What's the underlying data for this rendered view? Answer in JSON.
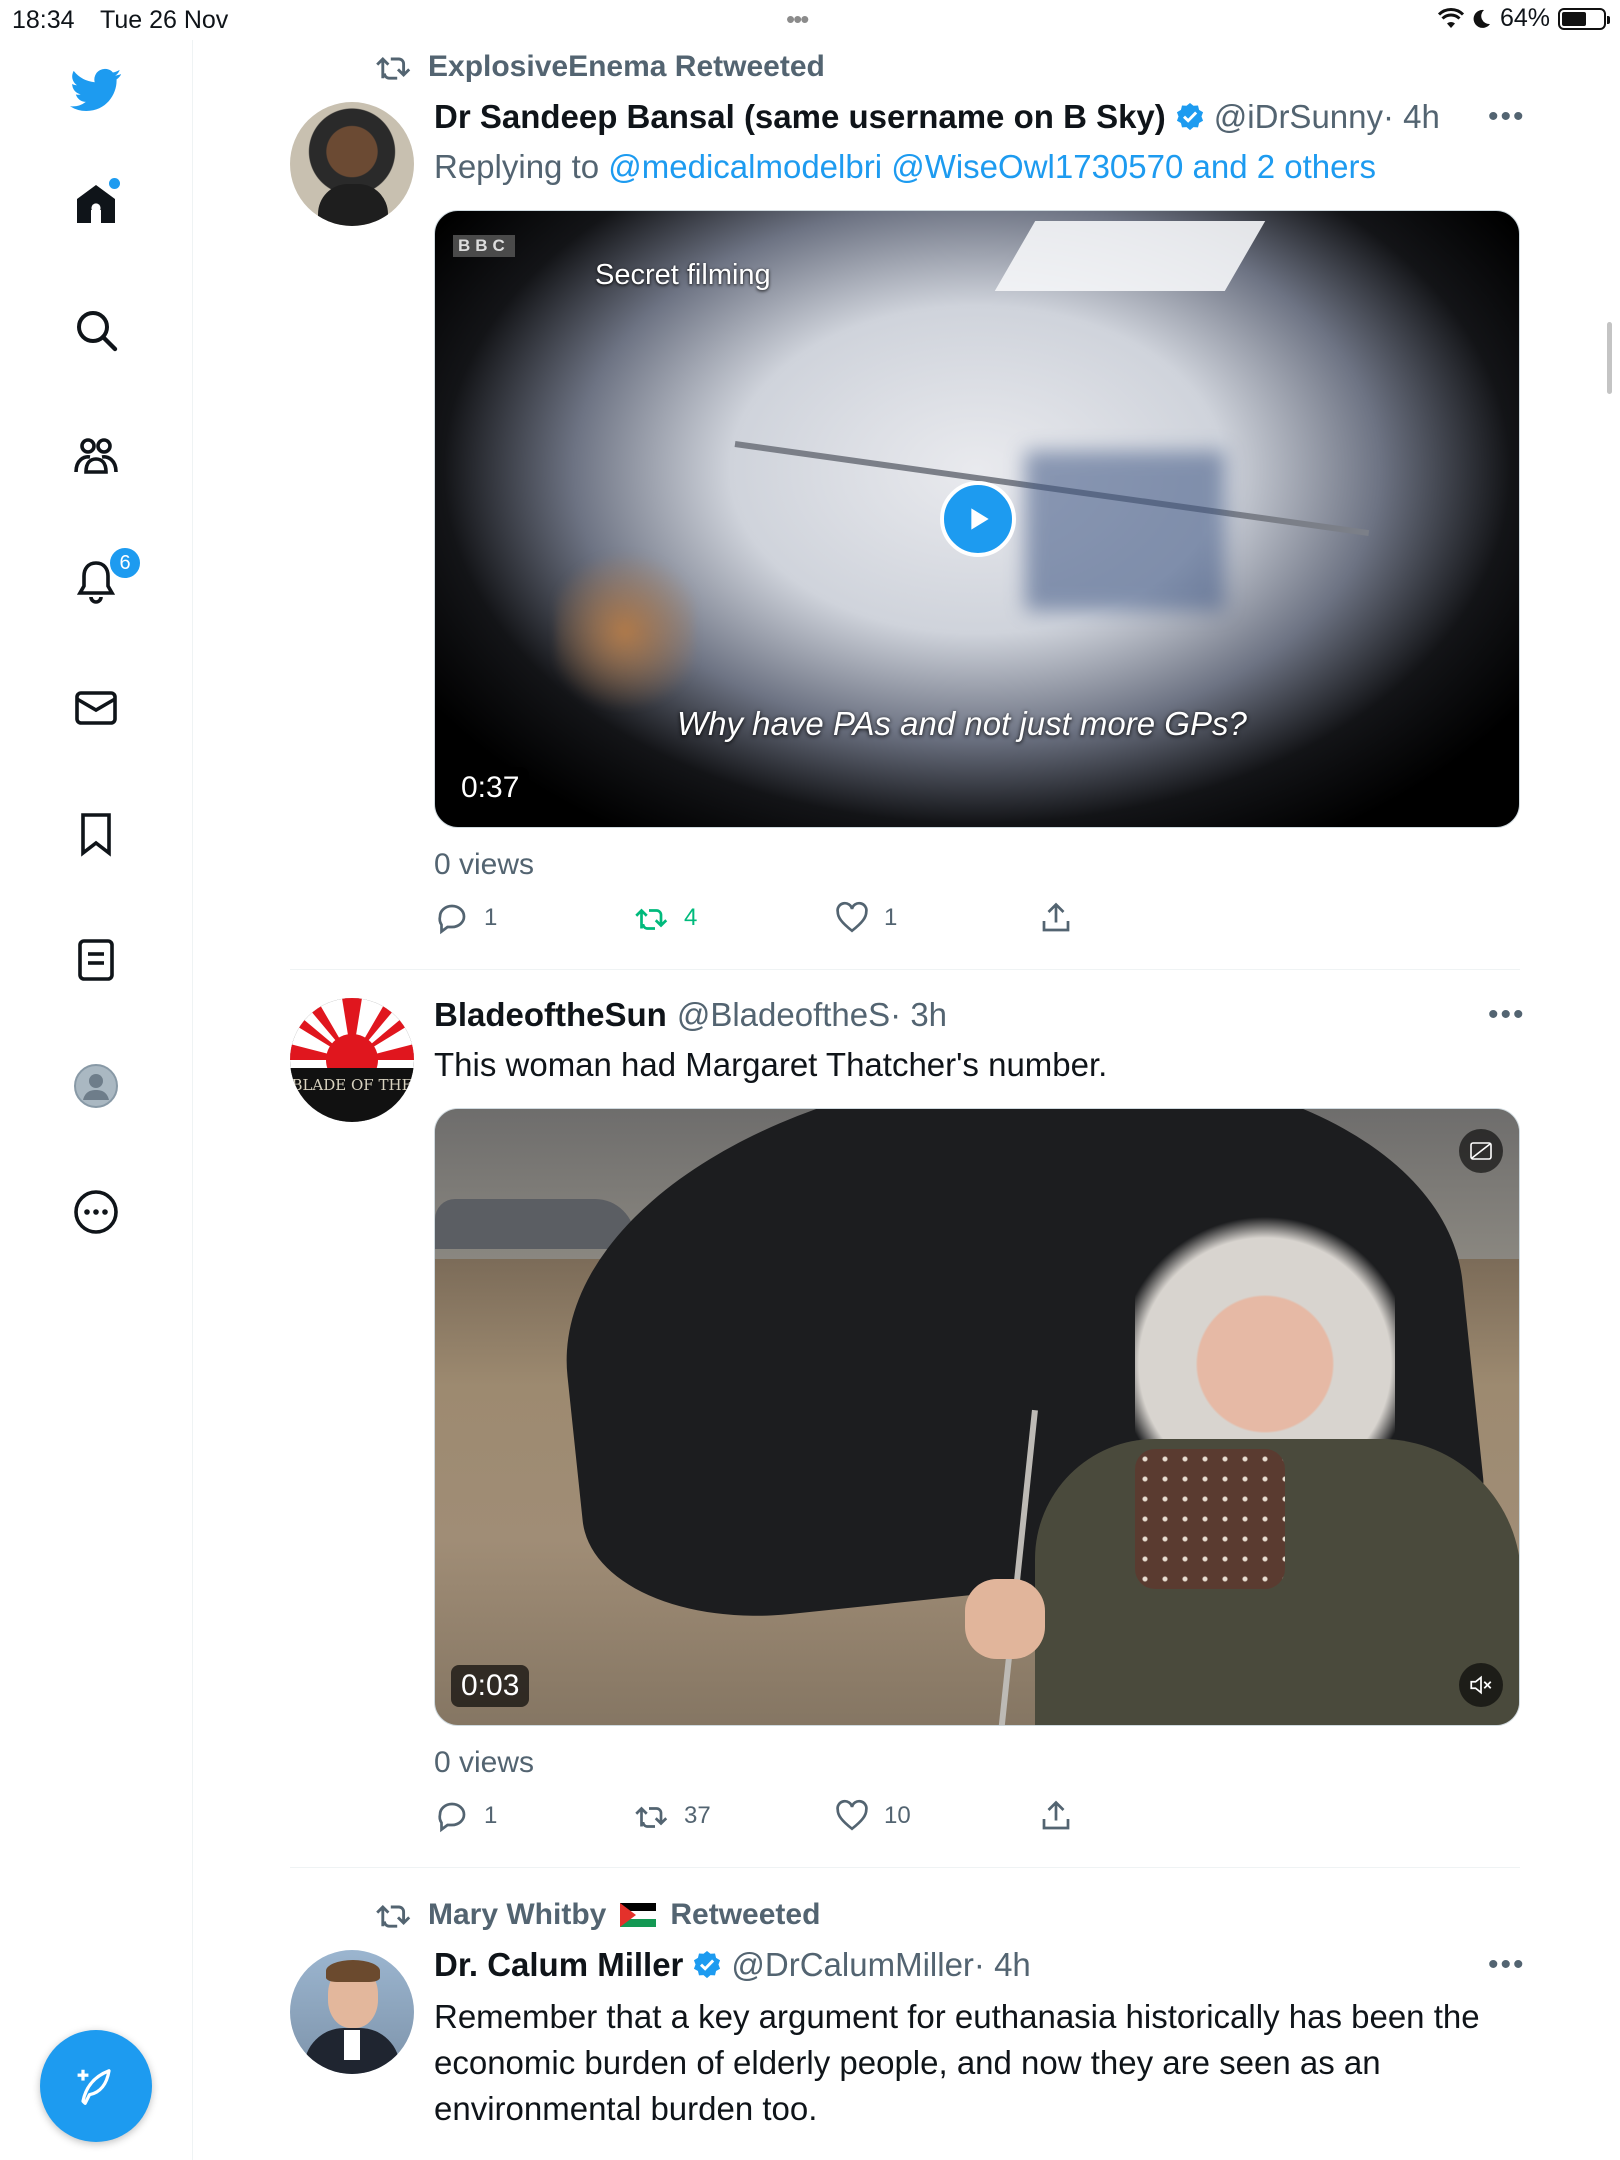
{
  "status_bar": {
    "time": "18:34",
    "date": "Tue 26 Nov",
    "battery": "64%",
    "battery_level": 0.64
  },
  "sidebar": {
    "items": [
      {
        "name": "home",
        "icon": "home-icon"
      },
      {
        "name": "explore",
        "icon": "search-icon"
      },
      {
        "name": "communities",
        "icon": "communities-icon"
      },
      {
        "name": "notifications",
        "icon": "bell-icon",
        "badge": "6"
      },
      {
        "name": "messages",
        "icon": "mail-icon"
      },
      {
        "name": "bookmarks",
        "icon": "bookmark-icon"
      },
      {
        "name": "lists",
        "icon": "lists-icon"
      },
      {
        "name": "profile",
        "icon": "profile-icon"
      },
      {
        "name": "more",
        "icon": "more-icon"
      }
    ],
    "compose_icon": "compose-feather-icon"
  },
  "tweets": [
    {
      "retweeted_by": "ExplosiveEnema Retweeted",
      "name": "Dr Sandeep Bansal (same username on B Sky)",
      "verified": true,
      "handle": "@iDrSunny",
      "time": " · 4h",
      "replying_prefix": "Replying to ",
      "replying_to": "@medicalmodelbri @WiseOwl1730570 and 2 others",
      "media": {
        "source_logo": "BBC",
        "overlay_top": "Secret filming",
        "subtitle": "Why have PAs and not just more GPs?",
        "duration": "0:37"
      },
      "views": "0 views",
      "replies": "1",
      "retweets": "4",
      "likes": "1"
    },
    {
      "name": "BladeoftheSun",
      "verified": false,
      "handle": "@BladeoftheS",
      "time": " · 3h",
      "avatar_text": "BLADE OF THE",
      "text": "This woman had Margaret Thatcher's number.",
      "media": {
        "duration": "0:03"
      },
      "views": "0 views",
      "replies": "1",
      "retweets": "37",
      "likes": "10"
    },
    {
      "retweeted_by_name": "Mary Whitby",
      "retweeted_suffix": "Retweeted",
      "name": "Dr. Calum Miller",
      "verified": true,
      "handle": "@DrCalumMiller",
      "time": " · 4h",
      "text": "Remember that a key argument for euthanasia historically has been the economic burden of elderly people, and now they are seen as an environmental burden too."
    }
  ],
  "colors": {
    "accent": "#1d9bf0",
    "retweet_green": "#00ba7c",
    "secondary_text": "#536471"
  }
}
